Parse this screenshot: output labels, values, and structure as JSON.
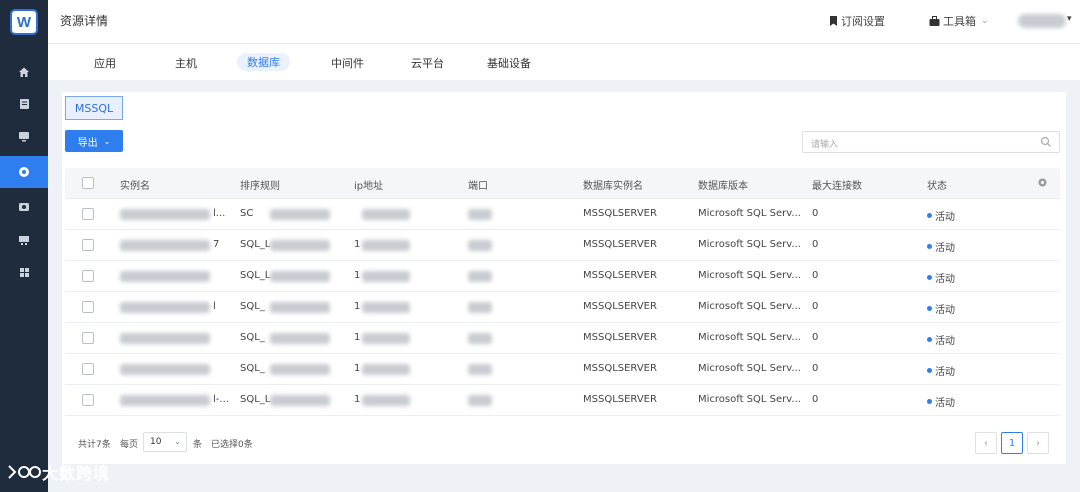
{
  "app": {
    "logo_letter": "W",
    "watermark_brand": "大数跨境"
  },
  "header": {
    "title": "资源详情",
    "subscribe_label": "订阅设置",
    "toolbox_label": "工具箱",
    "toolbox_caret": "⌄",
    "user_caret": "▾"
  },
  "sidebar": {
    "items": [
      {
        "icon": "home-icon"
      },
      {
        "icon": "document-icon"
      },
      {
        "icon": "monitor-icon"
      },
      {
        "icon": "database-icon",
        "active": true
      },
      {
        "icon": "camera-icon"
      },
      {
        "icon": "display-icon"
      },
      {
        "icon": "grid-icon"
      }
    ]
  },
  "tabs": [
    {
      "label": "应用"
    },
    {
      "label": "主机"
    },
    {
      "label": "数据库",
      "active": true
    },
    {
      "label": "中间件"
    },
    {
      "label": "云平台"
    },
    {
      "label": "基础设备"
    }
  ],
  "filter": {
    "tag_label": "MSSQL"
  },
  "toolbar": {
    "export_label": "导出",
    "export_caret": "⌄"
  },
  "search": {
    "placeholder": "请输入"
  },
  "table": {
    "columns": [
      "实例名",
      "排序规则",
      "ip地址",
      "端口",
      "数据库实例名",
      "数据库版本",
      "最大连接数",
      "状态"
    ],
    "rows": [
      {
        "name_tail": "l...",
        "collation": "SC",
        "ip": "",
        "port": "",
        "instance": "MSSQLSERVER",
        "version": "Microsoft SQL Serv...",
        "max_conn": "0",
        "status": "活动"
      },
      {
        "name_tail": "7",
        "collation": "SQL_L",
        "ip": "1",
        "port": "",
        "instance": "MSSQLSERVER",
        "version": "Microsoft SQL Serv...",
        "max_conn": "0",
        "status": "活动"
      },
      {
        "name_tail": "",
        "collation": "SQL_L",
        "ip": "1",
        "port": "",
        "instance": "MSSQLSERVER",
        "version": "Microsoft SQL Serv...",
        "max_conn": "0",
        "status": "活动"
      },
      {
        "name_tail": "l",
        "collation": "SQL_",
        "ip": "1",
        "port": "",
        "instance": "MSSQLSERVER",
        "version": "Microsoft SQL Serv...",
        "max_conn": "0",
        "status": "活动"
      },
      {
        "name_tail": "",
        "collation": "SQL_",
        "ip": "1",
        "port": "",
        "instance": "MSSQLSERVER",
        "version": "Microsoft SQL Serv...",
        "max_conn": "0",
        "status": "活动"
      },
      {
        "name_tail": "",
        "collation": "SQL_",
        "ip": "1",
        "port": "",
        "instance": "MSSQLSERVER",
        "version": "Microsoft SQL Serv...",
        "max_conn": "0",
        "status": "活动"
      },
      {
        "name_tail": "l-...",
        "collation": "SQL_L",
        "ip": "1",
        "port": "",
        "instance": "MSSQLSERVER",
        "version": "Microsoft SQL Serv...",
        "max_conn": "0",
        "status": "活动"
      }
    ]
  },
  "footer": {
    "total_label": "共计7条",
    "per_page_label": "每页",
    "page_size": "10",
    "unit_label": "条",
    "selected_label": "已选择0条",
    "current_page": "1",
    "prev": "‹",
    "next": "›"
  },
  "colors": {
    "accent": "#2f7ef0",
    "sidebar_bg": "#1f2c3d"
  }
}
